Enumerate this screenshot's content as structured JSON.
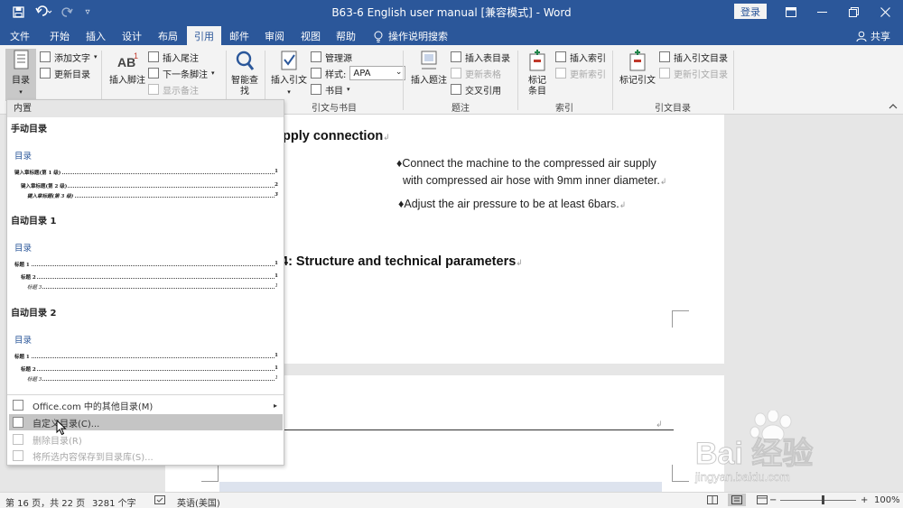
{
  "app": {
    "doc_title": "B63-6 English user manual [兼容模式] - Word",
    "login_label": "登录",
    "qat": {
      "save": "save-icon",
      "undo": "undo-icon",
      "redo": "redo-icon",
      "customize": "▿"
    }
  },
  "tabs": [
    {
      "label": "文件",
      "active": false
    },
    {
      "label": "开始",
      "active": false
    },
    {
      "label": "插入",
      "active": false
    },
    {
      "label": "设计",
      "active": false
    },
    {
      "label": "布局",
      "active": false
    },
    {
      "label": "引用",
      "active": true
    },
    {
      "label": "邮件",
      "active": false
    },
    {
      "label": "审阅",
      "active": false
    },
    {
      "label": "视图",
      "active": false
    },
    {
      "label": "帮助",
      "active": false
    }
  ],
  "tell_me": "操作说明搜索",
  "share": "共享",
  "ribbon": {
    "toc": {
      "label": "目录",
      "add_text": "添加文字",
      "update_toc": "更新目录"
    },
    "footnotes": {
      "insert_footnote": "插入脚注",
      "insert_endnote": "插入尾注",
      "next_footnote": "下一条脚注",
      "show_notes": "显示备注"
    },
    "research": {
      "smart_lookup": "智能查找"
    },
    "citations": {
      "insert_citation": "插入引文",
      "manage_sources": "管理源",
      "style_label": "样式:",
      "style_value": "APA",
      "bibliography": "书目",
      "group_label": "引文与书目"
    },
    "captions": {
      "insert_caption": "插入题注",
      "insert_table_figures": "插入表目录",
      "update_table": "更新表格",
      "cross_reference": "交叉引用",
      "group_label": "题注"
    },
    "index": {
      "mark_entry": "标记条目",
      "insert_index": "插入索引",
      "update_index": "更新索引",
      "group_label": "索引"
    },
    "toa": {
      "mark_citation": "标记引文",
      "insert_toa": "插入引文目录",
      "update_toa": "更新引文目录",
      "group_label": "引文目录"
    }
  },
  "dropdown": {
    "header": "内置",
    "manual": {
      "name": "手动目录",
      "title": "目录",
      "lines": [
        {
          "label": "键入章标题(第 1 级)",
          "page": "1"
        },
        {
          "label": "键入章标题(第 2 级)",
          "page": "2"
        },
        {
          "label": "键入章标题(第 3 级)",
          "page": "3"
        }
      ]
    },
    "auto1": {
      "name": "自动目录 1",
      "title": "目录",
      "lines": [
        {
          "label": "标题 1",
          "page": "1"
        },
        {
          "label": "标题 2",
          "page": "1"
        },
        {
          "label": "标题 3",
          "page": "1"
        }
      ]
    },
    "auto2": {
      "name": "自动目录 2",
      "title": "目录",
      "lines": [
        {
          "label": "标题 1",
          "page": "1"
        },
        {
          "label": "标题 2",
          "page": "1"
        },
        {
          "label": "标题 3",
          "page": "1"
        }
      ]
    },
    "more_office": "Office.com 中的其他目录(M)",
    "custom_toc": "自定义目录(C)...",
    "remove_toc": "删除目录(R)",
    "save_selection": "将所选内容保存到目录库(S)..."
  },
  "document": {
    "heading1": "pply connection",
    "bullet1_line1": "Connect the machine to the compressed air supply",
    "bullet1_line2": "with compressed air hose with 9mm inner diameter.",
    "bullet2": "Adjust the air pressure to be at least 6bars.",
    "heading2": "4: Structure and technical parameters"
  },
  "status": {
    "page": "第 16 页，共 22 页",
    "words": "3281 个字",
    "language": "英语(美国)",
    "zoom": "100%"
  },
  "watermark": {
    "text": "Bai 经验",
    "url": "jingyan.baidu.com"
  }
}
